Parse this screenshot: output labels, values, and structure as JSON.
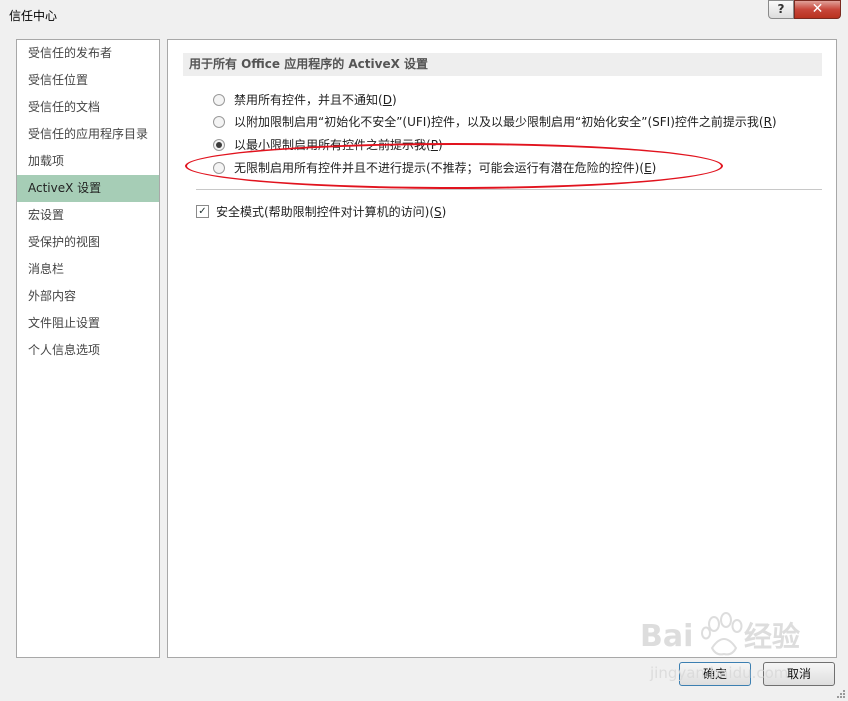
{
  "window": {
    "title": "信任中心",
    "help_label": "?",
    "close_label": "✕"
  },
  "sidebar": {
    "items": [
      {
        "label": "受信任的发布者"
      },
      {
        "label": "受信任位置"
      },
      {
        "label": "受信任的文档"
      },
      {
        "label": "受信任的应用程序目录"
      },
      {
        "label": "加载项"
      },
      {
        "label": "ActiveX 设置"
      },
      {
        "label": "宏设置"
      },
      {
        "label": "受保护的视图"
      },
      {
        "label": "消息栏"
      },
      {
        "label": "外部内容"
      },
      {
        "label": "文件阻止设置"
      },
      {
        "label": "个人信息选项"
      }
    ],
    "active_index": 5
  },
  "main": {
    "section_title": "用于所有 Office 应用程序的 ActiveX 设置",
    "options": [
      {
        "text": "禁用所有控件，并且不通知(",
        "key": "D",
        "suffix": ")",
        "checked": false
      },
      {
        "text": "以附加限制启用“初始化不安全”(UFI)控件，以及以最少限制启用“初始化安全”(SFI)控件之前提示我(",
        "key": "R",
        "suffix": ")",
        "checked": false
      },
      {
        "text": "以最小限制启用所有控件之前提示我(",
        "key": "P",
        "suffix": ")",
        "checked": true
      },
      {
        "text": "无限制启用所有控件并且不进行提示(不推荐；可能会运行有潜在危险的控件)(",
        "key": "E",
        "suffix": ")",
        "checked": false
      }
    ],
    "safe_mode": {
      "text": "安全模式(帮助限制控件对计算机的访问)(",
      "key": "S",
      "suffix": ")",
      "checked": true,
      "check_glyph": "✓"
    }
  },
  "buttons": {
    "ok": "确定",
    "cancel": "取消"
  },
  "watermark": {
    "text": "Bai经验",
    "subtext": "jingyan.baidu.com"
  },
  "colors": {
    "active_nav": "#a6cdb6",
    "annotation": "#e1131e"
  }
}
